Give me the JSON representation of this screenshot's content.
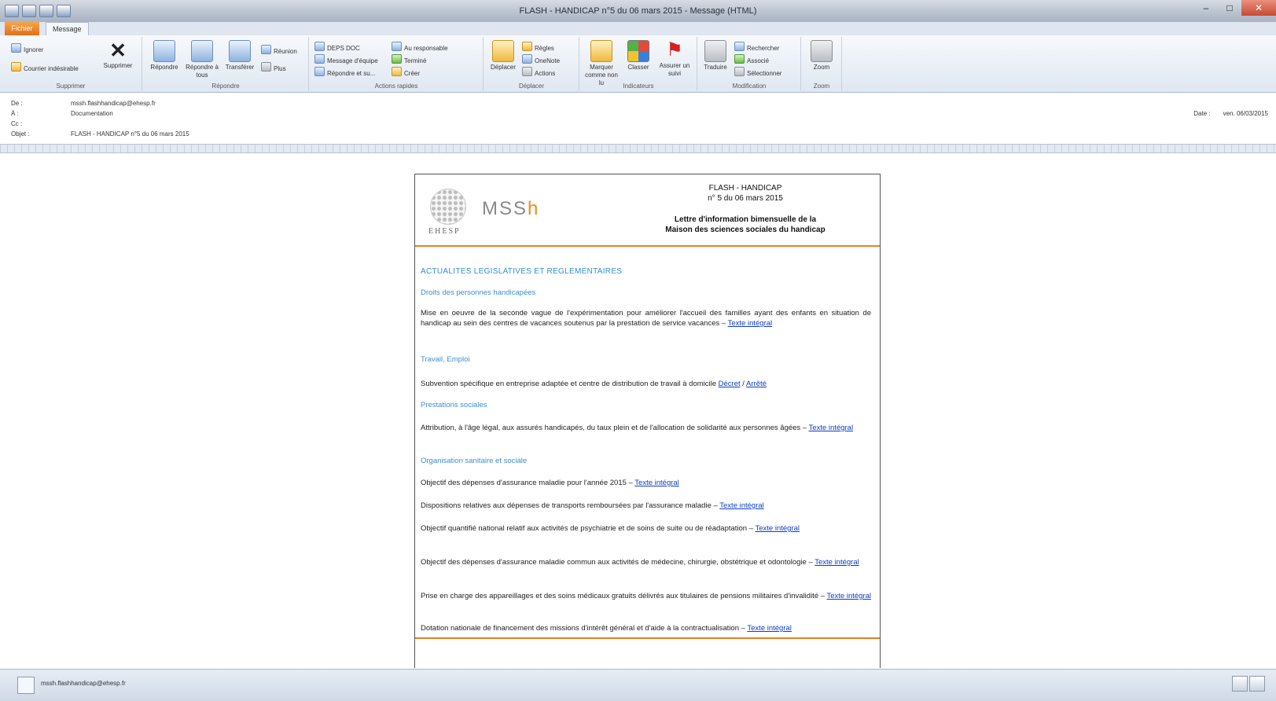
{
  "window": {
    "title": "FLASH - HANDICAP n°5 du 06 mars 2015 - Message (HTML)",
    "controls": [
      "–",
      "□",
      "✕"
    ]
  },
  "tabs": {
    "file": "Fichier",
    "message": "Message"
  },
  "ribbon": {
    "groups": {
      "supprimer": "Supprimer",
      "repondre": "Répondre",
      "actions_rapides": "Actions rapides",
      "deplacer": "Déplacer",
      "indicateurs": "Indicateurs",
      "modification": "Modification",
      "zoom": "Zoom"
    },
    "ignore": "Ignorer",
    "junk": "Courrier indésirable",
    "delete": "Supprimer",
    "reply": "Répondre",
    "reply_all": "Répondre à tous",
    "forward": "Transférer",
    "meeting": "Réunion",
    "more": "Plus",
    "quick_steps": [
      "DEPS DOC",
      "Message d'équipe",
      "Répondre et su...",
      "Au responsable",
      "Terminé",
      "Créer"
    ],
    "move": "Déplacer",
    "rules": "Règles",
    "onenote": "OneNote",
    "actions": "Actions",
    "mark_unread": "Marquer comme non lu",
    "categorize": "Classer",
    "followup": "Assurer un suivi",
    "translate": "Traduire",
    "find": "Rechercher",
    "related": "Associé",
    "select": "Sélectionner",
    "zoom": "Zoom"
  },
  "headers": {
    "from_label": "De :",
    "from_value": "mssh.flashhandicap@ehesp.fr",
    "to_label": "À :",
    "to_value": "Documentation",
    "cc_label": "Cc :",
    "cc_value": "",
    "subject_label": "Objet :",
    "subject_value": "FLASH - HANDICAP n°5 du 06 mars 2015",
    "date_label": "Date :",
    "date_value": "ven. 06/03/2015"
  },
  "newsletter": {
    "logo_org": "EHESP",
    "logo_brand_main": "MSS",
    "logo_brand_accent": "h",
    "flash": "FLASH - HANDICAP",
    "number": "n° 5 du 06 mars 2015",
    "subtitle1": "Lettre d'information bimensuelle de la",
    "subtitle2": "Maison des sciences sociales du handicap",
    "section_title": "ACTUALITES LEGISLATIVES ET REGLEMENTAIRES",
    "sub_droits": "Droits des personnes handicapées",
    "p1": "Mise en oeuvre de la seconde vague de l'expérimentation pour améliorer l'accueil des familles ayant des enfants en situation de handicap au sein des centres de vacances soutenus par la prestation de service vacances – ",
    "p1_link": "Texte intégral",
    "sub_travail": "Travail, Emploi",
    "p2": "Subvention spécifique en entreprise adaptée et centre de distribution de travail à domicile ",
    "p2_link1": "Décret",
    "p2_sep": " / ",
    "p2_link2": "Arrêté",
    "sub_prestations": "Prestations sociales",
    "p3": "Attribution, à l'âge légal, aux assurés handicapés, du taux plein et de l'allocation de solidarité aux personnes âgées – ",
    "p3_link": "Texte intégral",
    "sub_organisation": "Organisation sanitaire et sociale",
    "p4": "Objectif des dépenses d'assurance maladie pour l'année 2015 – ",
    "p4_link": "Texte intégral",
    "p5": "Dispositions relatives aux dépenses de transports remboursées par l'assurance maladie – ",
    "p5_link": "Texte intégral",
    "p6": "Objectif quantifié national relatif aux activités de psychiatrie et de soins de suite ou de réadaptation – ",
    "p6_link": "Texte intégral",
    "p7": "Objectif des dépenses d'assurance maladie commun aux activités de médecine, chirurgie, obstétrique et odontologie – ",
    "p7_link": "Texte intégral",
    "p8": "Prise en charge des appareillages et des soins médicaux gratuits délivrés aux titulaires de pensions militaires d'invalidité – ",
    "p8_link": "Texte intégral",
    "p9": "Dotation nationale de financement des missions d'intérêt général et d'aide à la contractualisation – ",
    "p9_link": "Texte intégral"
  },
  "statusbar": {
    "email": "mssh.flashhandicap@ehesp.fr"
  },
  "colors": {
    "accent_orange": "#e8821f",
    "link_blue": "#0f3fc0",
    "section_blue": "#2f8fd8"
  }
}
